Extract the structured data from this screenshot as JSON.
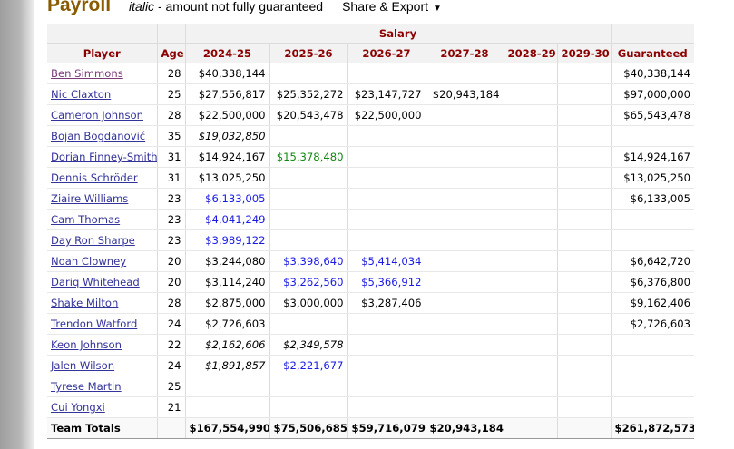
{
  "header": {
    "title": "Payroll",
    "legend_italic": "italic",
    "legend_rest": " - amount not fully guaranteed",
    "share_label": "Share & Export",
    "share_caret": "▼"
  },
  "table": {
    "group_label": "Salary",
    "columns": [
      "Player",
      "Age",
      "2024-25",
      "2025-26",
      "2026-27",
      "2027-28",
      "2028-29",
      "2029-30",
      "Guaranteed"
    ],
    "rows": [
      {
        "player": "Ben Simmons",
        "age": "28",
        "cells": [
          {
            "v": "$40,338,144",
            "s": "normal"
          },
          {
            "v": "",
            "s": "normal"
          },
          {
            "v": "",
            "s": "normal"
          },
          {
            "v": "",
            "s": "normal"
          },
          {
            "v": "",
            "s": "normal"
          },
          {
            "v": "",
            "s": "normal"
          }
        ],
        "guaranteed": "$40,338,144",
        "visited": true
      },
      {
        "player": "Nic Claxton",
        "age": "25",
        "cells": [
          {
            "v": "$27,556,817",
            "s": "normal"
          },
          {
            "v": "$25,352,272",
            "s": "normal"
          },
          {
            "v": "$23,147,727",
            "s": "normal"
          },
          {
            "v": "$20,943,184",
            "s": "normal"
          },
          {
            "v": "",
            "s": "normal"
          },
          {
            "v": "",
            "s": "normal"
          }
        ],
        "guaranteed": "$97,000,000"
      },
      {
        "player": "Cameron Johnson",
        "age": "28",
        "cells": [
          {
            "v": "$22,500,000",
            "s": "normal"
          },
          {
            "v": "$20,543,478",
            "s": "normal"
          },
          {
            "v": "$22,500,000",
            "s": "normal"
          },
          {
            "v": "",
            "s": "normal"
          },
          {
            "v": "",
            "s": "normal"
          },
          {
            "v": "",
            "s": "normal"
          }
        ],
        "guaranteed": "$65,543,478"
      },
      {
        "player": "Bojan Bogdanović",
        "age": "35",
        "cells": [
          {
            "v": "$19,032,850",
            "s": "italic"
          },
          {
            "v": "",
            "s": "normal"
          },
          {
            "v": "",
            "s": "normal"
          },
          {
            "v": "",
            "s": "normal"
          },
          {
            "v": "",
            "s": "normal"
          },
          {
            "v": "",
            "s": "normal"
          }
        ],
        "guaranteed": ""
      },
      {
        "player": "Dorian Finney-Smith",
        "age": "31",
        "cells": [
          {
            "v": "$14,924,167",
            "s": "normal"
          },
          {
            "v": "$15,378,480",
            "s": "green"
          },
          {
            "v": "",
            "s": "normal"
          },
          {
            "v": "",
            "s": "normal"
          },
          {
            "v": "",
            "s": "normal"
          },
          {
            "v": "",
            "s": "normal"
          }
        ],
        "guaranteed": "$14,924,167"
      },
      {
        "player": "Dennis Schröder",
        "age": "31",
        "cells": [
          {
            "v": "$13,025,250",
            "s": "normal"
          },
          {
            "v": "",
            "s": "normal"
          },
          {
            "v": "",
            "s": "normal"
          },
          {
            "v": "",
            "s": "normal"
          },
          {
            "v": "",
            "s": "normal"
          },
          {
            "v": "",
            "s": "normal"
          }
        ],
        "guaranteed": "$13,025,250"
      },
      {
        "player": "Ziaire Williams",
        "age": "23",
        "cells": [
          {
            "v": "$6,133,005",
            "s": "blue"
          },
          {
            "v": "",
            "s": "normal"
          },
          {
            "v": "",
            "s": "normal"
          },
          {
            "v": "",
            "s": "normal"
          },
          {
            "v": "",
            "s": "normal"
          },
          {
            "v": "",
            "s": "normal"
          }
        ],
        "guaranteed": "$6,133,005"
      },
      {
        "player": "Cam Thomas",
        "age": "23",
        "cells": [
          {
            "v": "$4,041,249",
            "s": "blue"
          },
          {
            "v": "",
            "s": "normal"
          },
          {
            "v": "",
            "s": "normal"
          },
          {
            "v": "",
            "s": "normal"
          },
          {
            "v": "",
            "s": "normal"
          },
          {
            "v": "",
            "s": "normal"
          }
        ],
        "guaranteed": ""
      },
      {
        "player": "Day'Ron Sharpe",
        "age": "23",
        "cells": [
          {
            "v": "$3,989,122",
            "s": "blue"
          },
          {
            "v": "",
            "s": "normal"
          },
          {
            "v": "",
            "s": "normal"
          },
          {
            "v": "",
            "s": "normal"
          },
          {
            "v": "",
            "s": "normal"
          },
          {
            "v": "",
            "s": "normal"
          }
        ],
        "guaranteed": ""
      },
      {
        "player": "Noah Clowney",
        "age": "20",
        "cells": [
          {
            "v": "$3,244,080",
            "s": "normal"
          },
          {
            "v": "$3,398,640",
            "s": "blue"
          },
          {
            "v": "$5,414,034",
            "s": "blue"
          },
          {
            "v": "",
            "s": "normal"
          },
          {
            "v": "",
            "s": "normal"
          },
          {
            "v": "",
            "s": "normal"
          }
        ],
        "guaranteed": "$6,642,720"
      },
      {
        "player": "Dariq Whitehead",
        "age": "20",
        "cells": [
          {
            "v": "$3,114,240",
            "s": "normal"
          },
          {
            "v": "$3,262,560",
            "s": "blue"
          },
          {
            "v": "$5,366,912",
            "s": "blue"
          },
          {
            "v": "",
            "s": "normal"
          },
          {
            "v": "",
            "s": "normal"
          },
          {
            "v": "",
            "s": "normal"
          }
        ],
        "guaranteed": "$6,376,800"
      },
      {
        "player": "Shake Milton",
        "age": "28",
        "cells": [
          {
            "v": "$2,875,000",
            "s": "normal"
          },
          {
            "v": "$3,000,000",
            "s": "normal"
          },
          {
            "v": "$3,287,406",
            "s": "normal"
          },
          {
            "v": "",
            "s": "normal"
          },
          {
            "v": "",
            "s": "normal"
          },
          {
            "v": "",
            "s": "normal"
          }
        ],
        "guaranteed": "$9,162,406"
      },
      {
        "player": "Trendon Watford",
        "age": "24",
        "cells": [
          {
            "v": "$2,726,603",
            "s": "normal"
          },
          {
            "v": "",
            "s": "normal"
          },
          {
            "v": "",
            "s": "normal"
          },
          {
            "v": "",
            "s": "normal"
          },
          {
            "v": "",
            "s": "normal"
          },
          {
            "v": "",
            "s": "normal"
          }
        ],
        "guaranteed": "$2,726,603"
      },
      {
        "player": "Keon Johnson",
        "age": "22",
        "cells": [
          {
            "v": "$2,162,606",
            "s": "italic"
          },
          {
            "v": "$2,349,578",
            "s": "italic"
          },
          {
            "v": "",
            "s": "normal"
          },
          {
            "v": "",
            "s": "normal"
          },
          {
            "v": "",
            "s": "normal"
          },
          {
            "v": "",
            "s": "normal"
          }
        ],
        "guaranteed": ""
      },
      {
        "player": "Jalen Wilson",
        "age": "24",
        "cells": [
          {
            "v": "$1,891,857",
            "s": "italic"
          },
          {
            "v": "$2,221,677",
            "s": "blue"
          },
          {
            "v": "",
            "s": "normal"
          },
          {
            "v": "",
            "s": "normal"
          },
          {
            "v": "",
            "s": "normal"
          },
          {
            "v": "",
            "s": "normal"
          }
        ],
        "guaranteed": ""
      },
      {
        "player": "Tyrese Martin",
        "age": "25",
        "cells": [
          {
            "v": "",
            "s": "normal"
          },
          {
            "v": "",
            "s": "normal"
          },
          {
            "v": "",
            "s": "normal"
          },
          {
            "v": "",
            "s": "normal"
          },
          {
            "v": "",
            "s": "normal"
          },
          {
            "v": "",
            "s": "normal"
          }
        ],
        "guaranteed": ""
      },
      {
        "player": "Cui Yongxi",
        "age": "21",
        "cells": [
          {
            "v": "",
            "s": "normal"
          },
          {
            "v": "",
            "s": "normal"
          },
          {
            "v": "",
            "s": "normal"
          },
          {
            "v": "",
            "s": "normal"
          },
          {
            "v": "",
            "s": "normal"
          },
          {
            "v": "",
            "s": "normal"
          }
        ],
        "guaranteed": ""
      }
    ],
    "totals": {
      "label": "Team Totals",
      "age": "",
      "cells": [
        "$167,554,990",
        "$75,506,685",
        "$59,716,079",
        "$20,943,184",
        "",
        ""
      ],
      "guaranteed": "$261,872,573"
    }
  },
  "colors": {
    "title": "#8a5a00",
    "header_text": "#8b0000",
    "link": "#33339a",
    "visited_link": "#7a3a7a",
    "blue_value": "#1a1ae6",
    "green_value": "#118811"
  }
}
